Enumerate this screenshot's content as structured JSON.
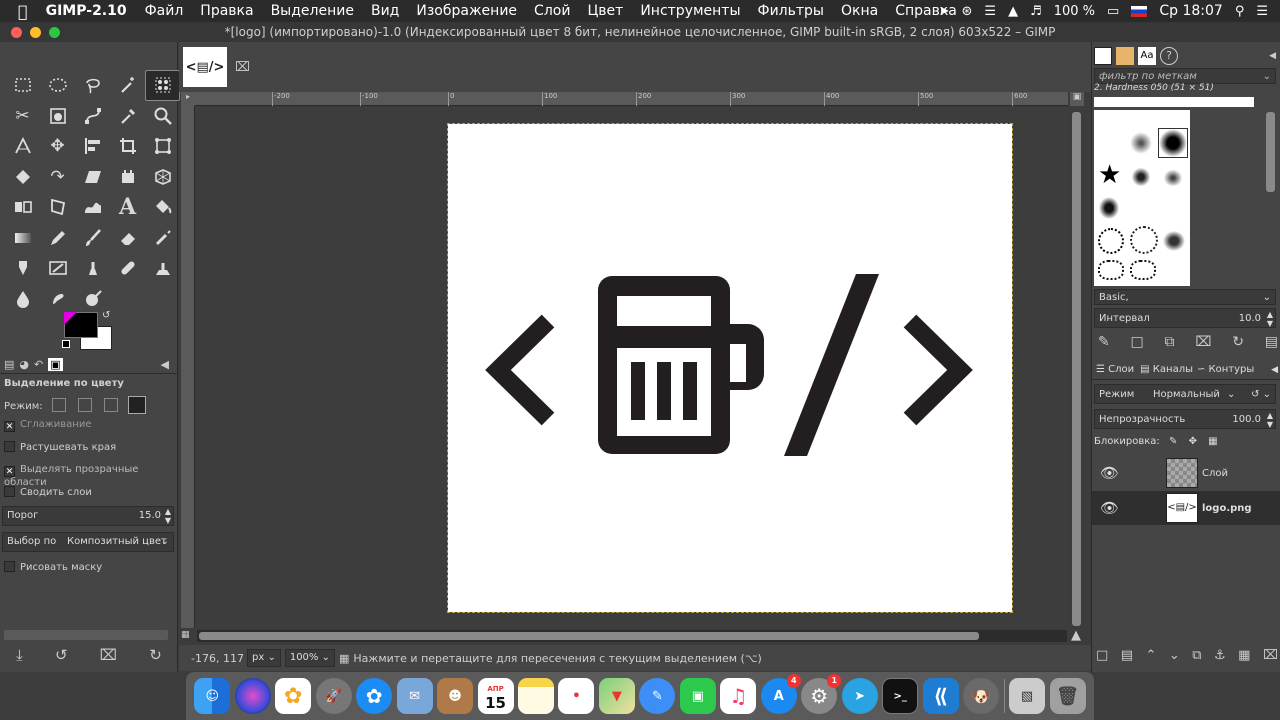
{
  "menubar": {
    "app_name": "GIMP-2.10",
    "items": [
      "Файл",
      "Правка",
      "Выделение",
      "Вид",
      "Изображение",
      "Слой",
      "Цвет",
      "Инструменты",
      "Фильтры",
      "Окна",
      "Справка"
    ],
    "battery": "100 %",
    "clock": "Ср 18:07"
  },
  "window": {
    "title": "*[logo] (импортировано)-1.0 (Индексированный цвет 8 бит, нелинейное целочисленное, GIMP built-in sRGB, 2 слоя) 603x522 – GIMP"
  },
  "image_tab": {
    "label": "<▤/>"
  },
  "ruler": {
    "labels": [
      "-200",
      "-100",
      "0",
      "100",
      "200",
      "300",
      "400",
      "500",
      "600"
    ]
  },
  "tool_options": {
    "title": "Выделение по цвету",
    "mode_label": "Режим:",
    "antialias": "Сглаживание",
    "feather": "Растушевать края",
    "select_transparent": "Выделять прозрачные области",
    "sample_merged": "Сводить слои",
    "threshold_label": "Порог",
    "threshold_value": "15.0",
    "select_by_label": "Выбор по",
    "select_by_value": "Композитный цвет",
    "draw_mask": "Рисовать маску"
  },
  "status": {
    "coords": "-176, 117",
    "unit": "px",
    "zoom": "100%",
    "message": "Нажмите и перетащите для пересечения с текущим выделением (⌥)"
  },
  "brushes": {
    "filter_placeholder": "фильтр по меткам",
    "current": "2. Hardness 050 (51 × 51)",
    "preset": "Basic,",
    "spacing_label": "Интервал",
    "spacing_value": "10.0"
  },
  "layers_panel": {
    "tabs": [
      "Слои",
      "Каналы",
      "Контуры"
    ],
    "mode_label": "Режим",
    "mode_value": "Нормальный",
    "opacity_label": "Непрозрачность",
    "opacity_value": "100.0",
    "lock_label": "Блокировка:",
    "layers": [
      {
        "name": "Слой"
      },
      {
        "name": "logo.png"
      }
    ]
  },
  "dock": {
    "calendar_month": "АПР",
    "calendar_day": "15",
    "appstore_badge": "4",
    "prefs_badge": "1"
  },
  "colors": {
    "fg": "#000000",
    "bg": "#ffffff",
    "accent": "#e000e0"
  }
}
